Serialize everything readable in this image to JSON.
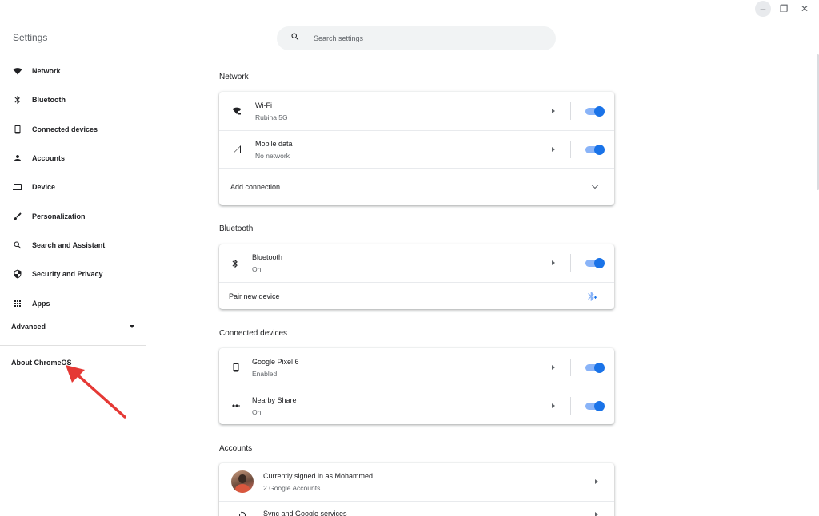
{
  "window": {
    "minimize_icon": "minimize-icon",
    "restore_icon": "restore-icon",
    "close_icon": "close-icon"
  },
  "sidebar": {
    "title": "Settings",
    "items": [
      {
        "label": "Network",
        "icon": "wifi-icon"
      },
      {
        "label": "Bluetooth",
        "icon": "bluetooth-icon"
      },
      {
        "label": "Connected devices",
        "icon": "phone-icon"
      },
      {
        "label": "Accounts",
        "icon": "person-icon"
      },
      {
        "label": "Device",
        "icon": "laptop-icon"
      },
      {
        "label": "Personalization",
        "icon": "brush-icon"
      },
      {
        "label": "Search and Assistant",
        "icon": "search-icon"
      },
      {
        "label": "Security and Privacy",
        "icon": "shield-icon"
      },
      {
        "label": "Apps",
        "icon": "apps-grid-icon"
      }
    ],
    "advanced_label": "Advanced",
    "about_label": "About ChromeOS"
  },
  "search": {
    "placeholder": "Search settings"
  },
  "sections": {
    "network": {
      "title": "Network",
      "wifi": {
        "primary": "Wi-Fi",
        "secondary": "Rubina 5G",
        "enabled": true
      },
      "mobile": {
        "primary": "Mobile data",
        "secondary": "No network",
        "enabled": true
      },
      "add_connection": "Add connection"
    },
    "bluetooth": {
      "title": "Bluetooth",
      "bt": {
        "primary": "Bluetooth",
        "secondary": "On",
        "enabled": true
      },
      "pair": "Pair new device"
    },
    "connected": {
      "title": "Connected devices",
      "phone": {
        "primary": "Google Pixel 6",
        "secondary": "Enabled",
        "enabled": true
      },
      "nearby": {
        "primary": "Nearby Share",
        "secondary": "On",
        "enabled": true
      }
    },
    "accounts": {
      "title": "Accounts",
      "signed_in": {
        "primary": "Currently signed in as Mohammed",
        "secondary": "2 Google Accounts"
      },
      "sync": {
        "primary": "Sync and Google services"
      }
    }
  },
  "colors": {
    "accent": "#1a73e8",
    "annotation_arrow": "#e53935"
  }
}
